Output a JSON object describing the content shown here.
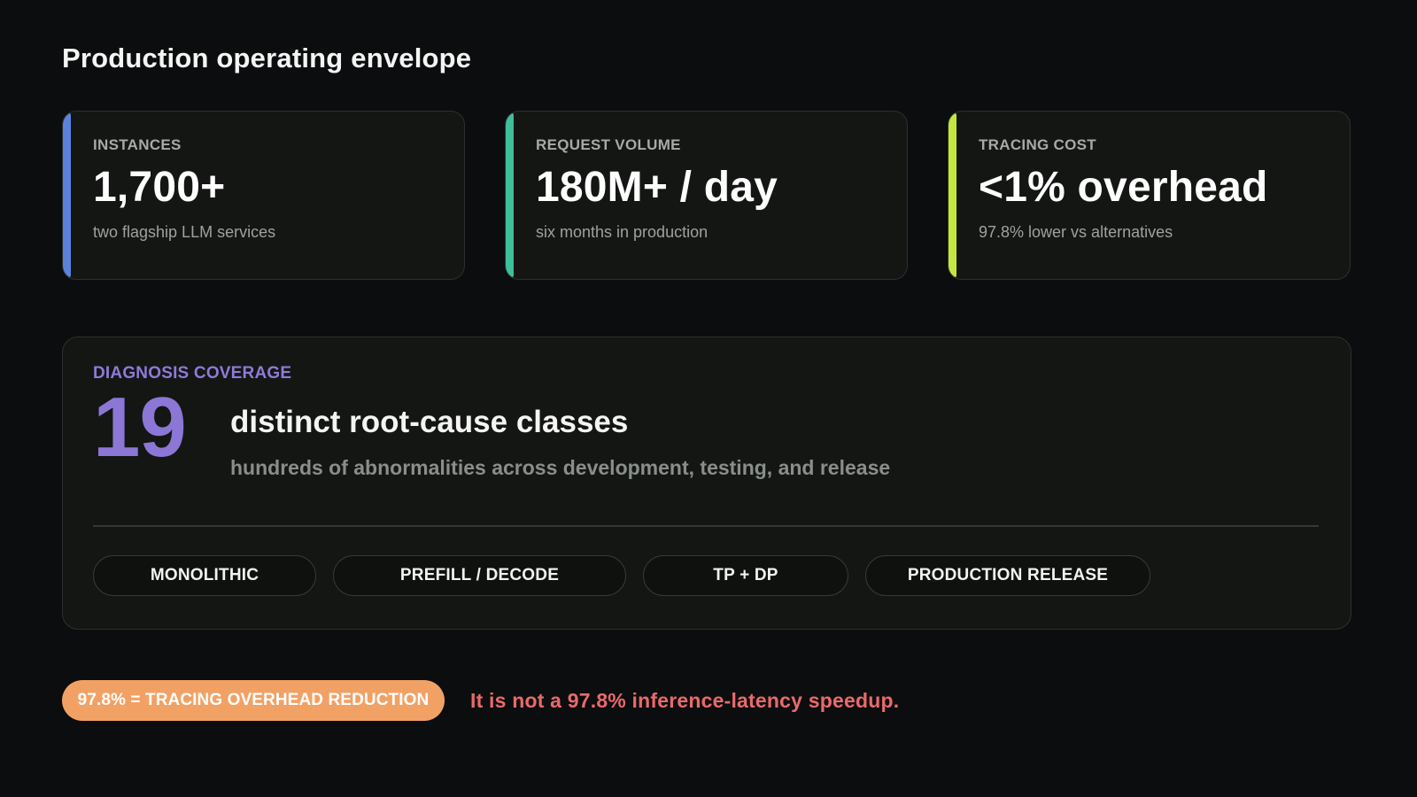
{
  "title": "Production operating envelope",
  "cards": [
    {
      "label": "INSTANCES",
      "value": "1,700+",
      "sub": "two flagship LLM services",
      "accent": "#5b82dd"
    },
    {
      "label": "REQUEST VOLUME",
      "value": "180M+ / day",
      "sub": "six months in production",
      "accent": "#3fbf9a"
    },
    {
      "label": "TRACING COST",
      "value": "<1% overhead",
      "sub": "97.8% lower vs alternatives",
      "accent": "#c5e63f"
    }
  ],
  "coverage": {
    "label": "DIAGNOSIS COVERAGE",
    "number": "19",
    "title": "distinct root-cause classes",
    "description": "hundreds of abnormalities across development, testing, and release",
    "tags": [
      "MONOLITHIC",
      "PREFILL / DECODE",
      "TP + DP",
      "PRODUCTION RELEASE"
    ]
  },
  "footer": {
    "pill": "97.8% = TRACING OVERHEAD REDUCTION",
    "warning": "It is not a 97.8% inference-latency speedup."
  },
  "colors": {
    "background": "#0c0d0f",
    "coverage_accent": "#8c77d6",
    "pill": "#f2a165",
    "warning": "#e96a6a"
  }
}
